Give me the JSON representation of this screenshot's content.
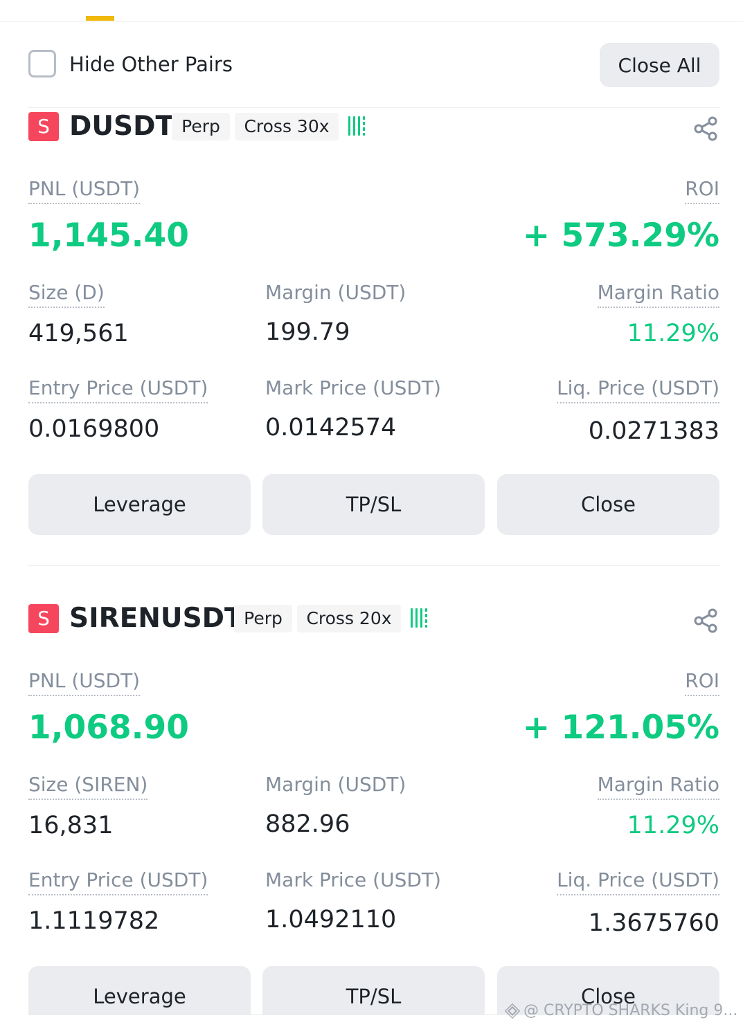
{
  "toolbar": {
    "hide_other_pairs": "Hide Other Pairs",
    "close_all": "Close All"
  },
  "colors": {
    "positive": "#0ecb81",
    "short_badge": "#f6465d",
    "accent": "#f0b90b",
    "button_bg": "#eaecef"
  },
  "positions": [
    {
      "side": "S",
      "symbol": "DUSDT",
      "type_tag": "Perp",
      "margin_tag": "Cross 30x",
      "pnl_label": "PNL (USDT)",
      "pnl_value": "1,145.40",
      "roi_label": "ROI",
      "roi_value": "+ 573.29%",
      "size_label": "Size (D)",
      "size_value": "419,561",
      "margin_label": "Margin (USDT)",
      "margin_value": "199.79",
      "margin_ratio_label": "Margin Ratio",
      "margin_ratio_value": "11.29%",
      "entry_price_label": "Entry Price (USDT)",
      "entry_price_value": "0.0169800",
      "mark_price_label": "Mark Price (USDT)",
      "mark_price_value": "0.0142574",
      "liq_price_label": "Liq. Price (USDT)",
      "liq_price_value": "0.0271383",
      "buttons": {
        "leverage": "Leverage",
        "tpsl": "TP/SL",
        "close": "Close"
      }
    },
    {
      "side": "S",
      "symbol": "SIRENUSDT",
      "type_tag": "Perp",
      "margin_tag": "Cross 20x",
      "pnl_label": "PNL (USDT)",
      "pnl_value": "1,068.90",
      "roi_label": "ROI",
      "roi_value": "+ 121.05%",
      "size_label": "Size (SIREN)",
      "size_value": "16,831",
      "margin_label": "Margin (USDT)",
      "margin_value": "882.96",
      "margin_ratio_label": "Margin Ratio",
      "margin_ratio_value": "11.29%",
      "entry_price_label": "Entry Price (USDT)",
      "entry_price_value": "1.1119782",
      "mark_price_label": "Mark Price (USDT)",
      "mark_price_value": "1.0492110",
      "liq_price_label": "Liq. Price (USDT)",
      "liq_price_value": "1.3675760",
      "buttons": {
        "leverage": "Leverage",
        "tpsl": "TP/SL",
        "close": "Close"
      }
    }
  ],
  "watermark": "@ CRYPTO SHARKS King 9..."
}
